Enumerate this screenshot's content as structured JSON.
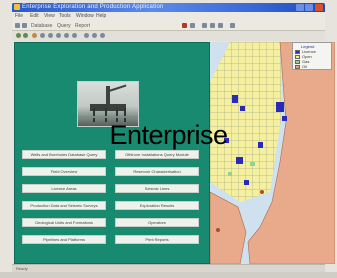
{
  "window": {
    "title": "Enterprise Exploration and Production Application",
    "menu": [
      "File",
      "Edit",
      "View",
      "Tools",
      "Window",
      "Help"
    ],
    "toolbar_labels": [
      "Database",
      "Query",
      "Report"
    ]
  },
  "overlay": {
    "watermark": "Enterprise"
  },
  "left_panel": {
    "buttons_left": [
      "Wells and Boreholes Database Query",
      "Field Overview",
      "Licence Areas",
      "Production Data and Seismic Surveys",
      "Geological Units and Formations",
      "Pipelines and Platforms"
    ],
    "buttons_right": [
      "Offshore Installations Query Module",
      "Reservoir Characterisation",
      "Seismic Lines",
      "Exploration Results",
      "Operators",
      "Print Reports"
    ]
  },
  "map": {
    "legend_title": "Legend",
    "legend_items": [
      {
        "label": "Licence",
        "color": "#2f2fbf"
      },
      {
        "label": "Open",
        "color": "#f2ee82"
      },
      {
        "label": "Gas",
        "color": "#8fd48f"
      },
      {
        "label": "Oil",
        "color": "#e8a07a"
      }
    ],
    "land_color": "#e9aa8c",
    "sea_color": "#cfe1ee",
    "block_color": "#f4f0a0",
    "licence_color": "#2a2ab8"
  },
  "status": {
    "text": "Ready"
  },
  "colors": {
    "panel": "#188a70",
    "button": "#eef1ec",
    "titlebar": "#2a59c9"
  }
}
